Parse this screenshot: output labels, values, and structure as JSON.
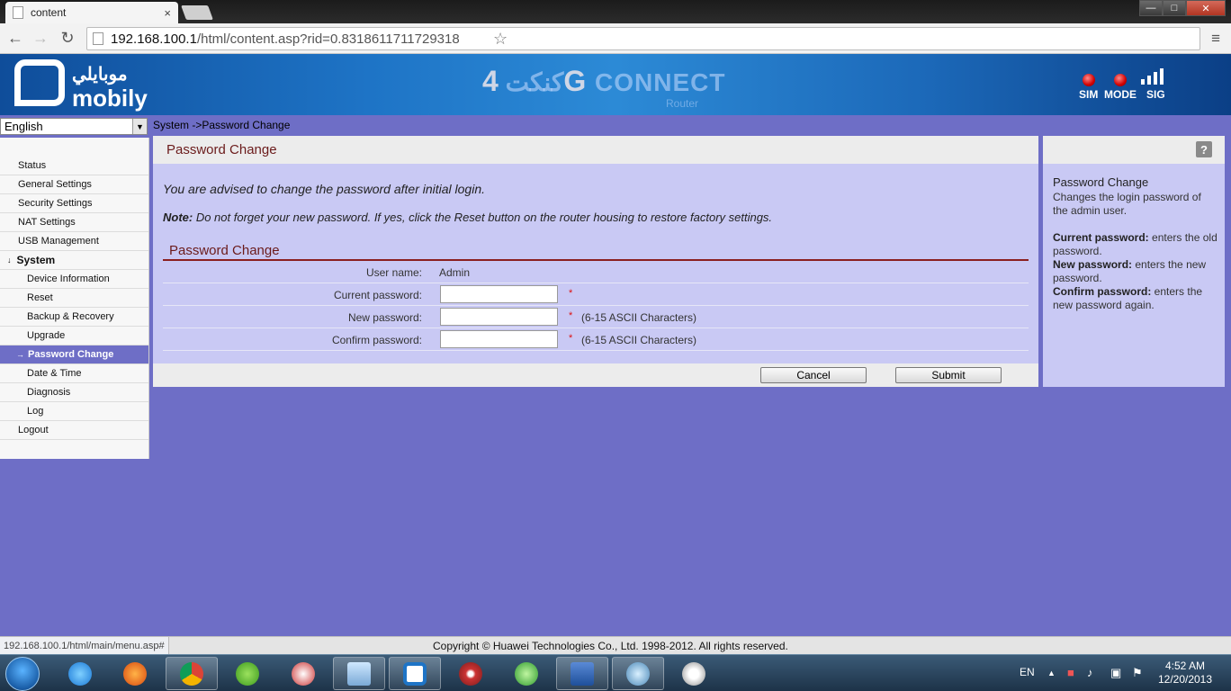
{
  "browser": {
    "tab_title": "content",
    "tab_close": "×",
    "url_host": "192.168.100.1",
    "url_path": "/html/content.asp?rid=0.8318611711729318",
    "back": "←",
    "forward": "→",
    "reload": "↻",
    "star": "☆",
    "menu": "≡",
    "win_min": "—",
    "win_max": "□",
    "win_close": "✕"
  },
  "banner": {
    "logo_arabic": "موبايلي",
    "logo_english": "mobily",
    "brand_arabic": "كنكت",
    "brand_4g": "4G",
    "brand_connect": "CONNECT",
    "brand_router": "Router",
    "indicators": [
      "SIM",
      "MODE",
      "SIG"
    ],
    "indicator_color": "#d10000"
  },
  "language": {
    "selected": "English",
    "arrow": "▼"
  },
  "menu": {
    "status": "Status",
    "general": "General Settings",
    "security": "Security Settings",
    "nat": "NAT Settings",
    "usb": "USB Management",
    "system_marker": "↓",
    "system": "System",
    "device_info": "Device Information",
    "reset": "Reset",
    "backup": "Backup & Recovery",
    "upgrade": "Upgrade",
    "password_marker": "→",
    "password_change": "Password Change",
    "date_time": "Date & Time",
    "diagnosis": "Diagnosis",
    "log": "Log",
    "logout": "Logout",
    "active_color": "#6e6ec6"
  },
  "breadcrumb": "System ->Password Change",
  "panel": {
    "title": "Password Change",
    "advice": "You are advised to change the password after initial login.",
    "note_label": "Note:",
    "note_text": " Do not forget your new password. If yes, click the Reset button on the router housing to restore factory settings.",
    "section_title": "Password Change",
    "username_label": "User name:",
    "username_value": "Admin",
    "current_label": "Current password:",
    "new_label": "New password:",
    "confirm_label": "Confirm password:",
    "required": "*",
    "hint": "(6-15 ASCII Characters)",
    "cancel": "Cancel",
    "submit": "Submit",
    "title_color": "#6b1b1b"
  },
  "help": {
    "icon": "?",
    "title": "Password Change",
    "intro": "Changes the login password of the admin user.",
    "current_label": "Current password:",
    "current_text": " enters the old password.",
    "new_label": "New password:",
    "new_text": " enters the new password.",
    "confirm_label": "Confirm password:",
    "confirm_text": " enters the new password again."
  },
  "statusbar": {
    "hover_url": "192.168.100.1/html/main/menu.asp#",
    "copyright": "Copyright © Huawei Technologies Co., Ltd. 1998-2012. All rights reserved."
  },
  "taskbar": {
    "lang": "EN",
    "tray_up": "▲",
    "time": "4:52 AM",
    "date": "12/20/2013",
    "icons": [
      "ie-icon",
      "firefox-icon",
      "chrome-icon",
      "utorrent-icon",
      "snipping-tool-icon",
      "notepad-icon",
      "mobily-icon",
      "wifi-icon",
      "media-icon",
      "remote-icon",
      "network-icon",
      "search-icon"
    ]
  }
}
